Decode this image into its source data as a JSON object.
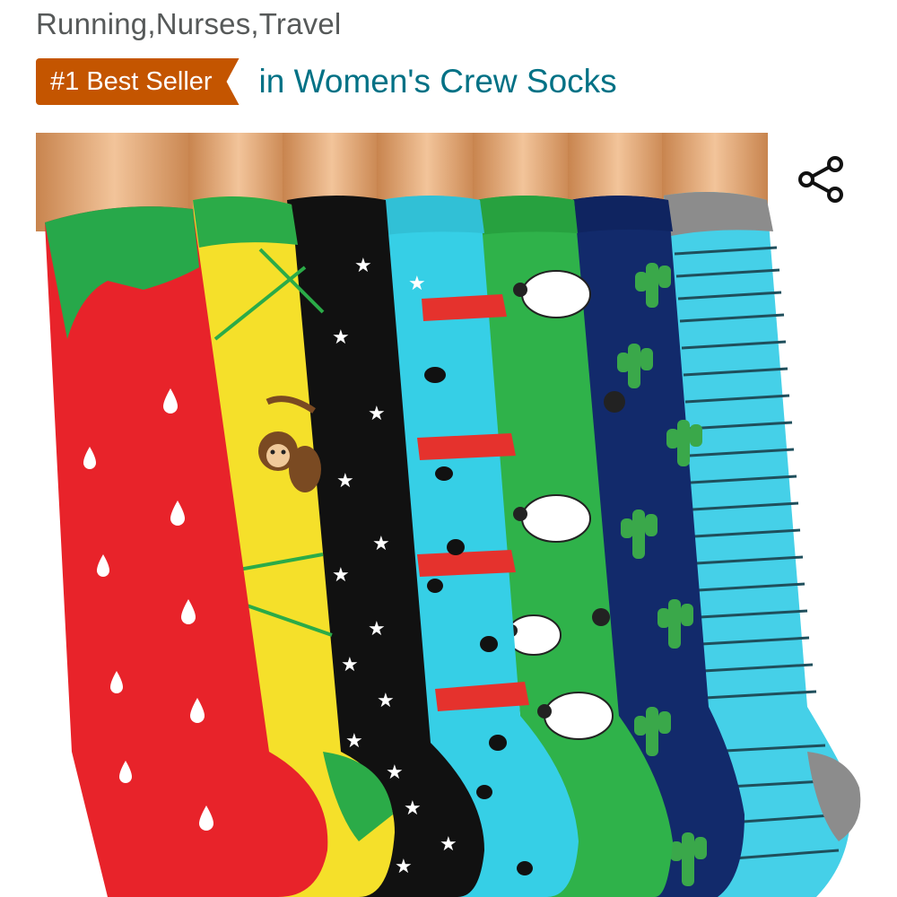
{
  "header": {
    "subtitle": "Running,Nurses,Travel",
    "badge_label": "#1 Best Seller",
    "badge_category": "in Women's Crew Socks"
  },
  "colors": {
    "badge_bg": "#c45500",
    "category_link": "#007185",
    "subtitle_text": "#565959"
  },
  "product_image": {
    "icon": "share-icon",
    "socks": [
      "strawberry-red",
      "monkey-yellow",
      "stars-black",
      "spots-cyan",
      "sheep-green",
      "cactus-navy",
      "stripes-cyan"
    ]
  }
}
